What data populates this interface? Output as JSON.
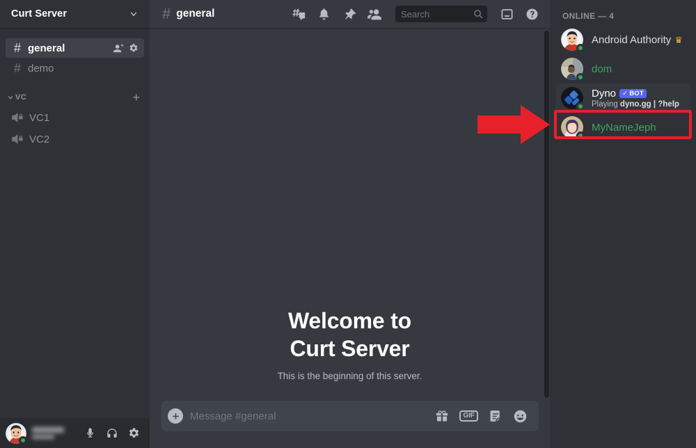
{
  "server": {
    "name": "Curt Server",
    "dropdown_icon": "chevron-down-icon"
  },
  "sidebar": {
    "text_channels": [
      {
        "name": "general",
        "active": true,
        "icons": [
          "add-member-icon",
          "gear-icon"
        ]
      },
      {
        "name": "demo",
        "active": false,
        "icons": []
      }
    ],
    "voice_group": {
      "label": "VC",
      "add_label": "+"
    },
    "voice_channels": [
      {
        "name": "VC1"
      },
      {
        "name": "VC2"
      }
    ]
  },
  "user_panel": {
    "username": "",
    "status": "online",
    "icons": [
      "microphone-icon",
      "headphones-icon",
      "user-settings-gear-icon"
    ]
  },
  "channel_header": {
    "hash": "#",
    "title": "general",
    "tools": [
      "create-thread-icon",
      "notification-bell-icon",
      "pinned-messages-icon",
      "member-list-icon",
      "inbox-icon",
      "help-icon"
    ]
  },
  "search": {
    "placeholder": "Search",
    "icon": "search-icon"
  },
  "welcome": {
    "line1": "Welcome to",
    "line2": "Curt Server",
    "subtitle": "This is the beginning of this server."
  },
  "composer": {
    "placeholder": "Message #general",
    "add_icon": "plus-circle-icon",
    "gift_icon": "gift-icon",
    "gif_label": "GIF",
    "sticker_icon": "sticker-icon",
    "emoji_icon": "emoji-icon"
  },
  "members": {
    "header": "ONLINE — 4",
    "list": [
      {
        "name": "Android Authority",
        "name_color": "#dcddde",
        "badge": "crown",
        "badge_glyph": "♛",
        "bot": false,
        "status": "online",
        "activity": null
      },
      {
        "name": "dom",
        "name_color": "#3ba55d",
        "badge": null,
        "bot": false,
        "status": "online",
        "activity": null
      },
      {
        "name": "Dyno",
        "name_color": "#ffffff",
        "badge": null,
        "bot": true,
        "bot_label": "BOT",
        "bot_check": "✓",
        "status": "online",
        "activity_prefix": "Playing ",
        "activity": "dyno.gg | ?help",
        "highlighted": true
      },
      {
        "name": "MyNameJeph",
        "name_color": "#3ba55d",
        "badge": null,
        "bot": false,
        "status": "online",
        "activity": null
      }
    ]
  },
  "annotation": {
    "type": "red-arrow-and-box",
    "color": "#e8202a",
    "target": "Dyno"
  },
  "colors": {
    "sidebar_bg": "#2f3136",
    "chat_bg": "#36393f",
    "user_panel_bg": "#292b2f",
    "composer_bg": "#40444b",
    "search_bg": "#202225",
    "accent_blurple": "#5865f2",
    "online_green": "#3ba55d",
    "annotation_red": "#e8202a"
  }
}
